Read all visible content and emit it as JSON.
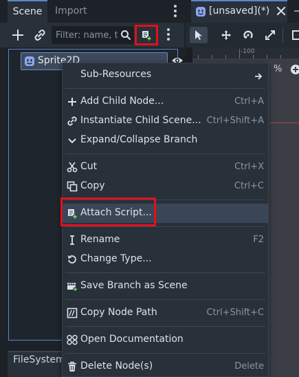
{
  "scene_dock": {
    "tabs": [
      {
        "label": "Scene",
        "active": true
      },
      {
        "label": "Import",
        "active": false
      }
    ],
    "filter_placeholder": "Filter: name, t",
    "tree": {
      "nodes": [
        {
          "label": "Sprite2D",
          "icon": "sprite2d-icon",
          "selected": true
        }
      ]
    }
  },
  "bottom_dock": {
    "tab_label": "FileSystem"
  },
  "editor": {
    "scene_tab_label": "[unsaved](*)",
    "ruler_label": "-100",
    "zoom_label": "%"
  },
  "context_menu": {
    "items": [
      {
        "label": "Sub-Resources",
        "shortcut": "",
        "icon": "",
        "submenu": true
      },
      {
        "label": "Add Child Node...",
        "shortcut": "Ctrl+A",
        "icon": "plus-icon"
      },
      {
        "label": "Instantiate Child Scene...",
        "shortcut": "Ctrl+Shift+A",
        "icon": "link-icon"
      },
      {
        "label": "Expand/Collapse Branch",
        "shortcut": "",
        "icon": "collapse-icon"
      },
      {
        "label": "Cut",
        "shortcut": "Ctrl+X",
        "icon": "scissors-icon"
      },
      {
        "label": "Copy",
        "shortcut": "Ctrl+C",
        "icon": "copy-icon"
      },
      {
        "label": "Attach Script...",
        "shortcut": "",
        "icon": "script-add-icon",
        "highlighted": true
      },
      {
        "label": "Rename",
        "shortcut": "F2",
        "icon": "text-cursor-icon"
      },
      {
        "label": "Change Type...",
        "shortcut": "",
        "icon": "rotate-icon"
      },
      {
        "label": "Save Branch as Scene",
        "shortcut": "",
        "icon": "save-scene-icon"
      },
      {
        "label": "Copy Node Path",
        "shortcut": "Ctrl+Shift+C",
        "icon": "copy-path-icon"
      },
      {
        "label": "Open Documentation",
        "shortcut": "",
        "icon": "docs-icon"
      },
      {
        "label": "Delete Node(s)",
        "shortcut": "Delete",
        "icon": "trash-icon"
      }
    ]
  },
  "colors": {
    "highlight_outline": "#e3101a",
    "accent": "#5b86c8",
    "node_icon": "#8da5f3"
  }
}
